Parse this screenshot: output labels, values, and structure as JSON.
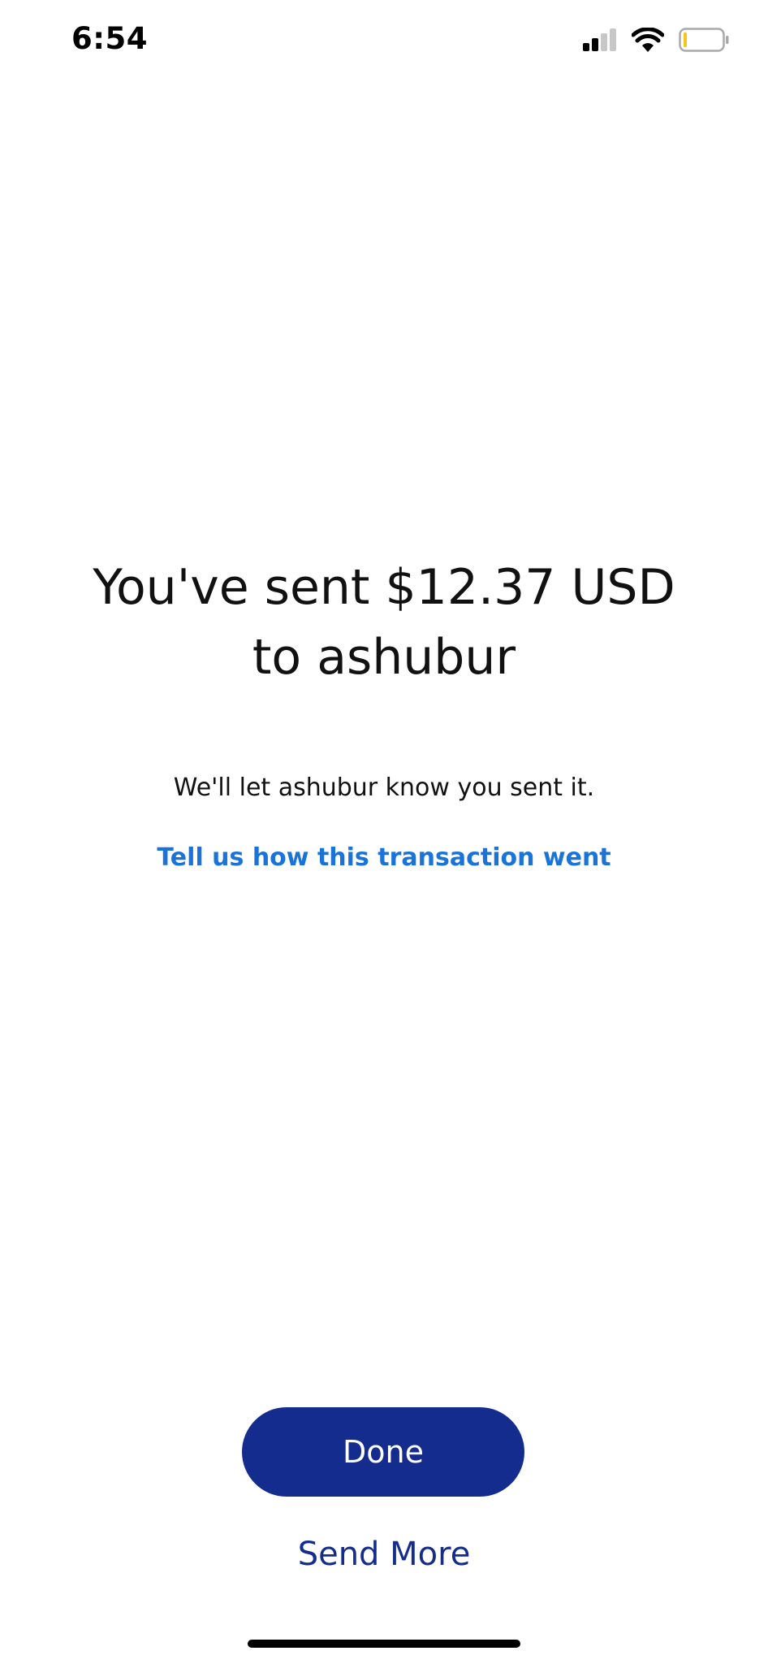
{
  "status_bar": {
    "time": "6:54",
    "icons": [
      "cellular-signal-icon",
      "wifi-icon",
      "battery-icon"
    ]
  },
  "confirmation": {
    "headline": "You've sent $12.37 USD to ashubur",
    "notice": "We'll let ashubur know you sent it.",
    "feedback_link": "Tell us how this transaction went"
  },
  "actions": {
    "done_label": "Done",
    "send_more_label": "Send More"
  },
  "colors": {
    "primary_button": "#142c8e",
    "link": "#1a73d9",
    "battery_low": "#f5c518"
  }
}
